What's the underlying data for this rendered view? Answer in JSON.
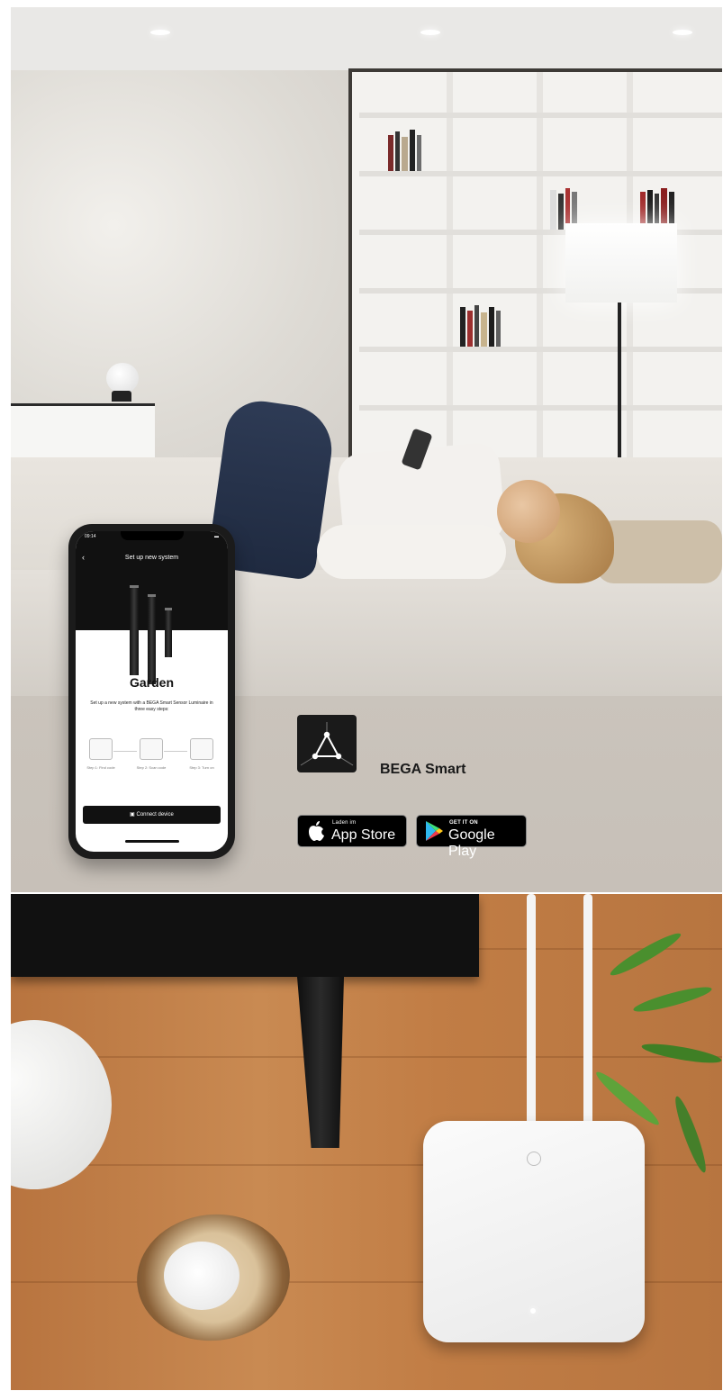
{
  "phone": {
    "status_time": "09:14",
    "screen_title": "Set up new system",
    "product_title": "Garden",
    "description": "Set up a new system with a BEGA Smart Sensor Luminaire in three easy steps:",
    "steps": [
      {
        "label": "Step 1: Find code"
      },
      {
        "label": "Step 2: Scan code"
      },
      {
        "label": "Step 3: Turn on"
      }
    ],
    "connect_button": "Connect device"
  },
  "app": {
    "name": "BEGA Smart",
    "icon": "bega-smart-triangle-icon"
  },
  "stores": {
    "appstore": {
      "small": "Laden im",
      "big": "App Store",
      "icon": "apple-icon"
    },
    "googleplay": {
      "small": "GET IT ON",
      "big": "Google Play",
      "icon": "google-play-icon"
    }
  },
  "colors": {
    "badge_bg": "#000000",
    "app_icon_bg": "#1a1a1a"
  }
}
